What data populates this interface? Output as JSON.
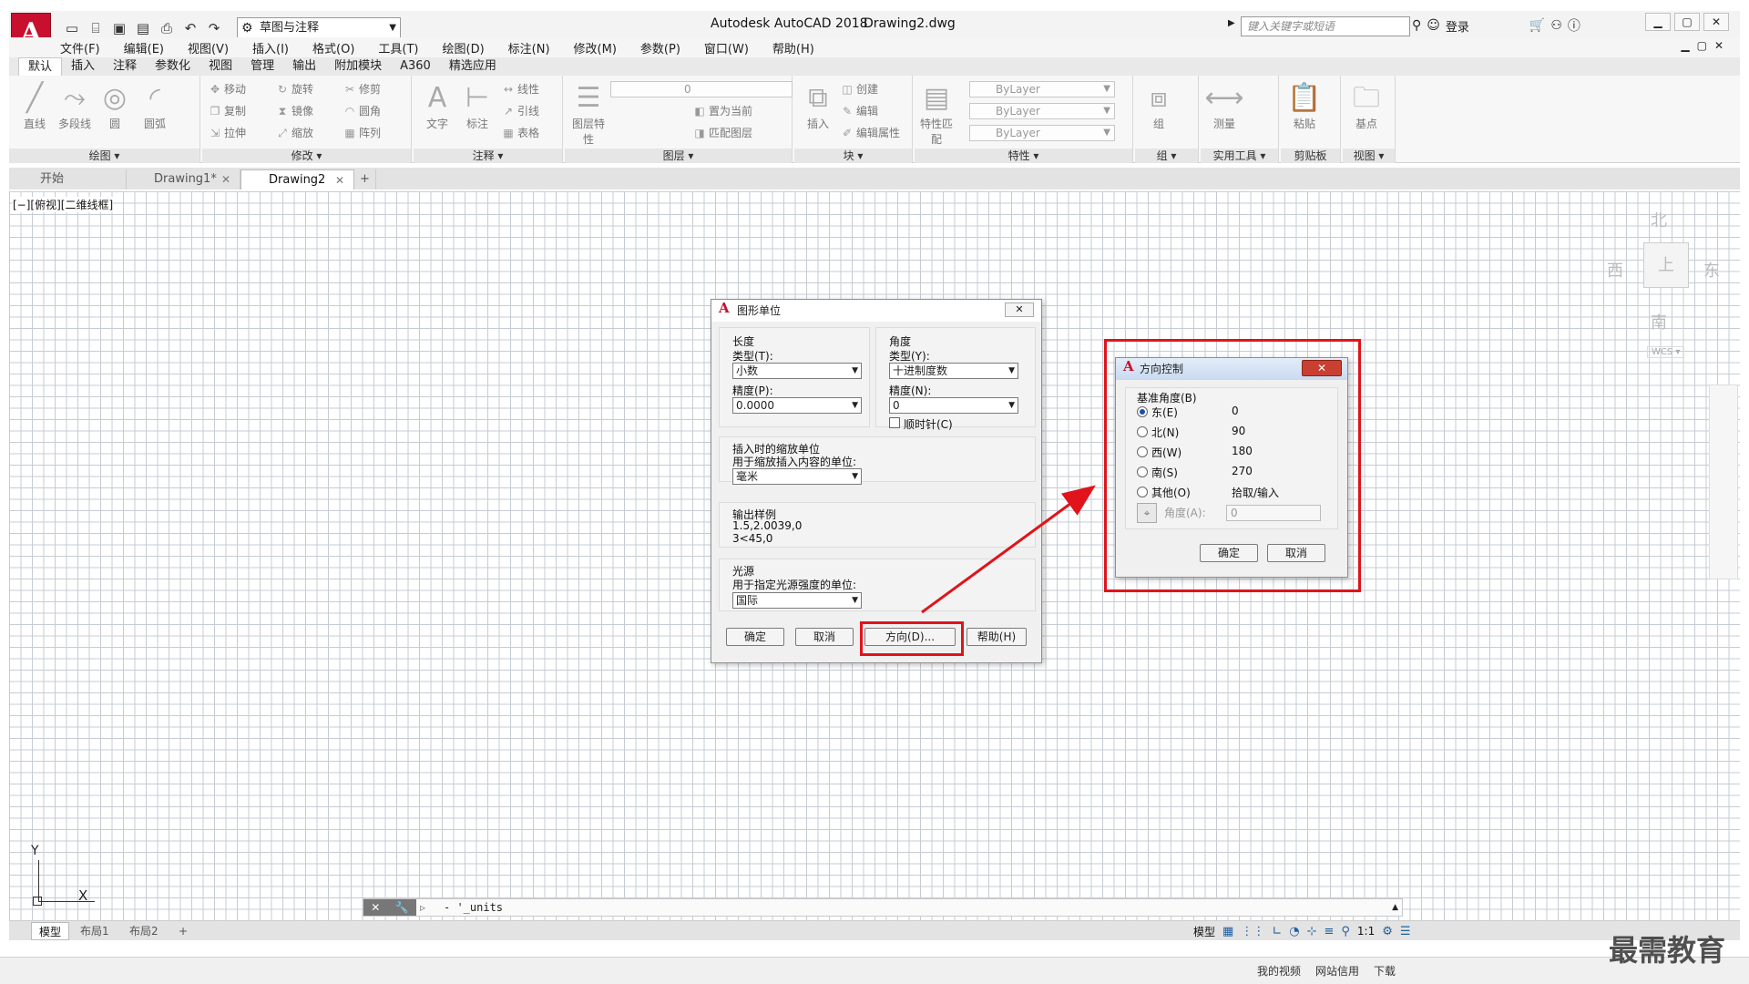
{
  "titlebar": {
    "app_title": "Autodesk AutoCAD 2018",
    "doc_name": "Drawing2.dwg",
    "workspace": "草图与注释",
    "search_placeholder": "键入关键字或短语",
    "login": "登录"
  },
  "menu": [
    "文件(F)",
    "编辑(E)",
    "视图(V)",
    "插入(I)",
    "格式(O)",
    "工具(T)",
    "绘图(D)",
    "标注(N)",
    "修改(M)",
    "参数(P)",
    "窗口(W)",
    "帮助(H)"
  ],
  "ribbon_tabs": [
    "默认",
    "插入",
    "注释",
    "参数化",
    "视图",
    "管理",
    "输出",
    "附加模块",
    "A360",
    "精选应用"
  ],
  "ribbon": {
    "draw": {
      "title": "绘图 ▾",
      "line": "直线",
      "polyline": "多段线",
      "circle": "圆",
      "arc": "圆弧"
    },
    "modify": {
      "title": "修改 ▾",
      "move": "移动",
      "rotate": "旋转",
      "trim": "修剪",
      "copy": "复制",
      "mirror": "镜像",
      "fillet": "圆角",
      "stretch": "拉伸",
      "scale": "缩放",
      "array": "阵列"
    },
    "annotation": {
      "title": "注释 ▾",
      "text": "文字",
      "dimension": "标注",
      "linear": "线性",
      "leader": "引线",
      "table": "表格"
    },
    "layers": {
      "title": "图层 ▾",
      "layer_props": "图层特性",
      "current_layer": "0",
      "set_current": "置为当前",
      "match_layer": "匹配图层"
    },
    "block": {
      "title": "块 ▾",
      "insert": "插入",
      "create": "创建",
      "edit": "编辑",
      "edit_attr": "编辑属性"
    },
    "properties": {
      "title": "特性 ▾",
      "match": "特性匹配",
      "color": "ByLayer",
      "linetype": "ByLayer",
      "lineweight": "ByLayer"
    },
    "group": {
      "title": "组 ▾",
      "group": "组"
    },
    "utilities": {
      "title": "实用工具 ▾",
      "measure": "测量"
    },
    "clipboard": {
      "title": "剪贴板",
      "paste": "粘贴"
    },
    "view": {
      "title": "视图 ▾",
      "base": "基点"
    }
  },
  "file_tabs": [
    {
      "label": "开始"
    },
    {
      "label": "Drawing1*"
    },
    {
      "label": "Drawing2"
    }
  ],
  "viewport_label": "[−][俯视][二维线框]",
  "viewcube": {
    "north": "北",
    "south": "南",
    "east": "东",
    "west": "西",
    "wcs": "WCS ▾"
  },
  "command_line": {
    "text": "- '_units"
  },
  "layout_tabs": [
    "模型",
    "布局1",
    "布局2"
  ],
  "statusbar": {
    "model": "模型",
    "scale": "1:1"
  },
  "taskbar": [
    "我的视频",
    "网站信用",
    "下载"
  ],
  "watermark": "最需教育",
  "units_dialog": {
    "title": "图形单位",
    "length": {
      "group": "长度",
      "type_label": "类型(T):",
      "type_value": "小数",
      "precision_label": "精度(P):",
      "precision_value": "0.0000"
    },
    "angle": {
      "group": "角度",
      "type_label": "类型(Y):",
      "type_value": "十进制度数",
      "precision_label": "精度(N):",
      "precision_value": "0",
      "clockwise": "顺时针(C)"
    },
    "insert_scale": {
      "group": "插入时的缩放单位",
      "label": "用于缩放插入内容的单位:",
      "value": "毫米"
    },
    "output_sample": {
      "group": "输出样例",
      "line1": "1.5,2.0039,0",
      "line2": "3<45,0"
    },
    "lighting": {
      "group": "光源",
      "label": "用于指定光源强度的单位:",
      "value": "国际"
    },
    "buttons": {
      "ok": "确定",
      "cancel": "取消",
      "direction": "方向(D)...",
      "help": "帮助(H)"
    }
  },
  "direction_dialog": {
    "title": "方向控制",
    "group": "基准角度(B)",
    "options": [
      {
        "label": "东(E)",
        "value": "0"
      },
      {
        "label": "北(N)",
        "value": "90"
      },
      {
        "label": "西(W)",
        "value": "180"
      },
      {
        "label": "南(S)",
        "value": "270"
      },
      {
        "label": "其他(O)",
        "value": "拾取/输入"
      }
    ],
    "angle_label": "角度(A):",
    "angle_value": "0",
    "ok": "确定",
    "cancel": "取消"
  },
  "colors": {
    "accent": "#c8102e",
    "highlight": "#e0141a"
  }
}
